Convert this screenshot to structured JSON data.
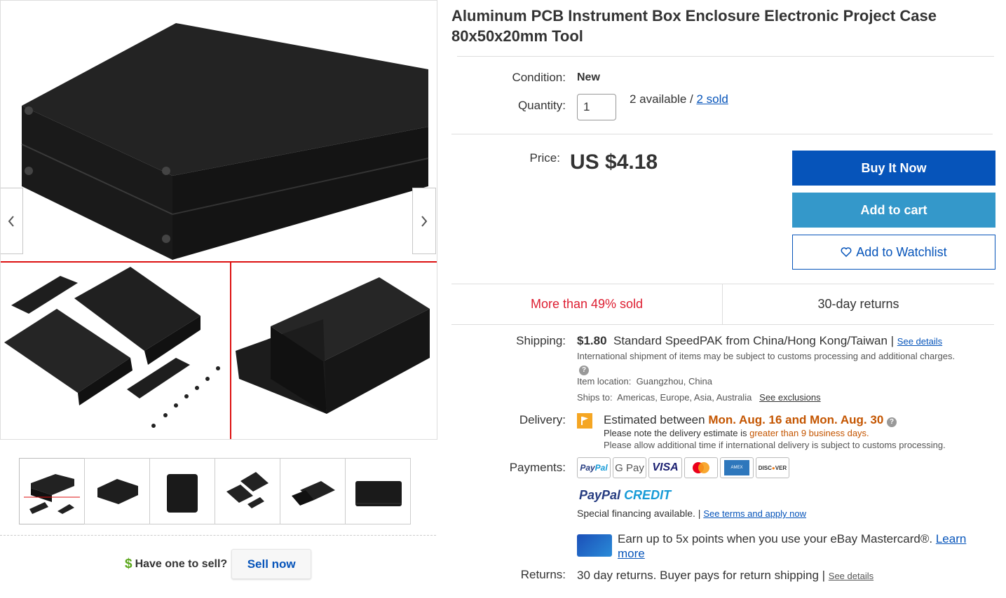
{
  "product": {
    "title_line1": "Aluminum PCB Instrument Box Enclosure Electronic Project Case",
    "title_line2": "80x50x20mm Tool"
  },
  "gallery": {
    "prev_icon": "chevron-left-icon",
    "next_icon": "chevron-right-icon",
    "thumbnail_count": 6
  },
  "sell": {
    "question": "Have one to sell?",
    "button": "Sell now"
  },
  "condition": {
    "label": "Condition:",
    "value": "New"
  },
  "quantity": {
    "label": "Quantity:",
    "value": "1",
    "available": "2 available / ",
    "sold_link": "2 sold"
  },
  "price": {
    "label": "Price:",
    "value": "US $4.18"
  },
  "buttons": {
    "buy_now": "Buy It Now",
    "add_to_cart": "Add to cart",
    "watchlist": "Add to Watchlist"
  },
  "stats": {
    "sold": "More than 49% sold",
    "returns": "30-day returns"
  },
  "shipping": {
    "label": "Shipping:",
    "cost": "$1.80",
    "service": "Standard SpeedPAK from China/Hong Kong/Taiwan | ",
    "see_details": "See details",
    "intl_note": "International shipment of items may be subject to customs processing and additional charges.",
    "item_location_label": "Item location:",
    "item_location": "Guangzhou, China",
    "ships_to_label": "Ships to:",
    "ships_to": "Americas, Europe, Asia, Australia",
    "see_exclusions": "See exclusions"
  },
  "delivery": {
    "label": "Delivery:",
    "estimated_prefix": "Estimated between ",
    "dates": "Mon. Aug. 16 and Mon. Aug. 30",
    "note_prefix": "Please note the delivery estimate is ",
    "note_highlight": "greater than 9 business days.",
    "note2": "Please allow additional time if international delivery is subject to customs processing."
  },
  "payments": {
    "label": "Payments:",
    "methods": [
      "PayPal",
      "G Pay",
      "VISA",
      "Mastercard",
      "American Express",
      "DISCOVER"
    ],
    "paypal_credit_a": "PayPal",
    "paypal_credit_b": "CREDIT",
    "financing": "Special financing available.",
    "financing_sep": " | ",
    "terms_link": "See terms and apply now",
    "mastercard_text": "Earn up to 5x points when you use your eBay Mastercard®.",
    "learn": "Learn",
    "more": "more"
  },
  "returns": {
    "label": "Returns:",
    "text": "30 day returns. Buyer pays for return shipping | ",
    "see_details": "See details"
  },
  "colors": {
    "primary_blue": "#0654ba",
    "cart_blue": "#3498ca",
    "sold_red": "#dd1e31",
    "delivery_orange": "#c45500"
  }
}
